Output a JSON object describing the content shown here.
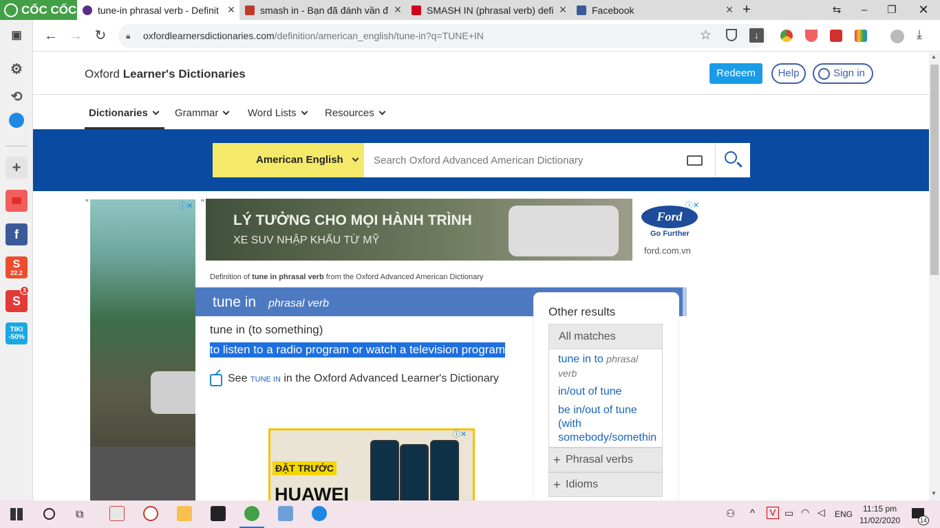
{
  "browser": {
    "brand": "CỐC CỐC",
    "tabs": [
      {
        "title": "tune-in phrasal verb - Definit",
        "active": true
      },
      {
        "title": "smash in - Bạn đã đánh vần đ",
        "active": false
      },
      {
        "title": "SMASH IN (phrasal verb) defi",
        "active": false
      },
      {
        "title": "Facebook",
        "active": false
      }
    ],
    "url_domain": "oxfordlearnersdictionaries.com",
    "url_path": "/definition/american_english/tune-in?q=TUNE+IN"
  },
  "sidebar": {
    "shopee_badge": "22.2",
    "notif_count": "3",
    "tiki_label": "TIKI",
    "tiki_discount": "-50%"
  },
  "site": {
    "title_plain": "Oxford ",
    "title_bold": "Learner's Dictionaries",
    "redeem": "Redeem",
    "help": "Help",
    "sign_in": "Sign in",
    "nav": [
      "Dictionaries",
      "Grammar",
      "Word Lists",
      "Resources"
    ],
    "dictionary_select": "American English",
    "search_placeholder": "Search Oxford Advanced American Dictionary"
  },
  "ads": {
    "top_line1": "LÝ TƯỞNG CHO MỌI HÀNH TRÌNH",
    "top_line2": "XE SUV NHẬP KHẨU TỪ MỸ",
    "ford_logo": "Ford",
    "ford_tagline": "Go Further",
    "ford_url": "ford.com.vn",
    "phone_tag": "ĐẶT TRƯỚC",
    "phone_brand": "HUAWEI"
  },
  "entry": {
    "source_prefix": "Definition of ",
    "source_term": "tune in phrasal verb",
    "source_suffix": " from the Oxford Advanced American Dictionary",
    "headword": "tune in",
    "pos": "phrasal verb",
    "sense_label": "tune in (to something)",
    "definition": "to listen to a radio program or watch a television program",
    "see_prefix": "See ",
    "see_term": "TUNE IN",
    "see_suffix": " in the Oxford Advanced Learner's Dictionary"
  },
  "other_results": {
    "title": "Other results",
    "all_matches": "All matches",
    "matches": [
      {
        "text": "tune in to ",
        "pos": "phrasal"
      },
      {
        "text": "verb"
      },
      {
        "text": "in/out of tune"
      },
      {
        "text": "be in/out of tune"
      },
      {
        "text": "(with"
      },
      {
        "text": "somebody/somethin"
      }
    ],
    "phrasal_verbs": "Phrasal verbs",
    "idioms": "Idioms"
  },
  "taskbar": {
    "lang": "ENG",
    "time": "11:15 pm",
    "date": "11/02/2020",
    "notifications": "14"
  }
}
